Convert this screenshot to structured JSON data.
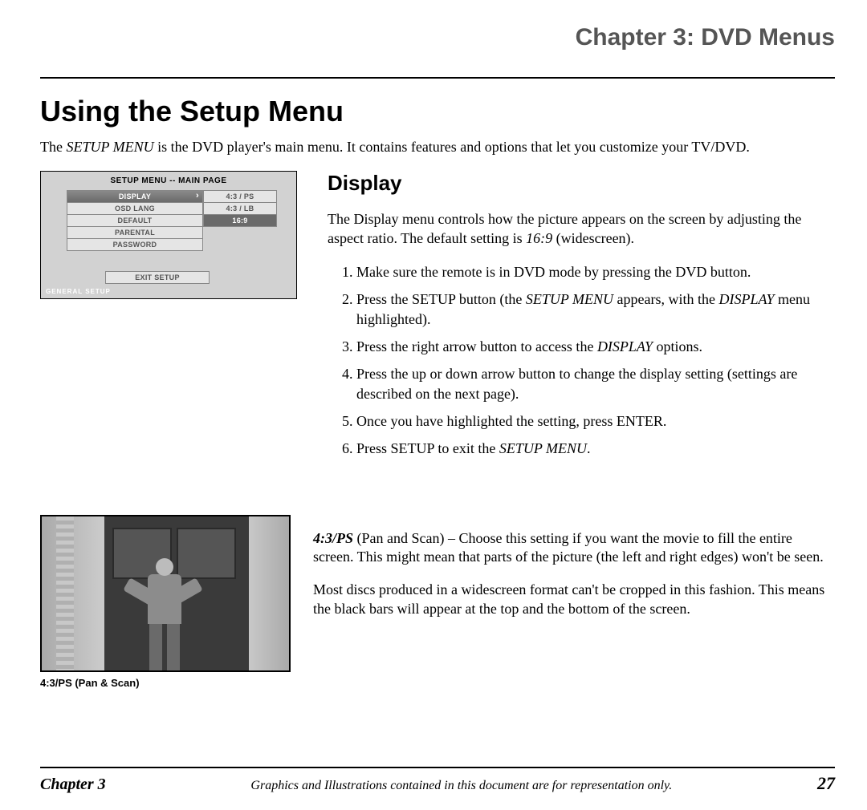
{
  "header": {
    "chapter_title": "Chapter 3: DVD Menus"
  },
  "section": {
    "title": "Using the Setup Menu",
    "intro_pre": "The ",
    "intro_em": "SETUP MENU",
    "intro_post": " is the DVD player's main menu. It contains features and options that let you customize your TV/DVD."
  },
  "menu_fig": {
    "title": "SETUP MENU -- MAIN PAGE",
    "left_items": [
      "DISPLAY",
      "OSD LANG",
      "DEFAULT",
      "PARENTAL",
      "PASSWORD"
    ],
    "right_items": [
      "4:3 / PS",
      "4:3 / LB",
      "16:9"
    ],
    "exit": "EXIT SETUP",
    "footer": "GENERAL SETUP"
  },
  "display": {
    "heading": "Display",
    "body_a": "The Display menu controls how the picture appears on the screen by adjusting the aspect ratio. The default setting is ",
    "body_em": "16:9",
    "body_b": " (widescreen).",
    "steps": {
      "s1": "Make sure the remote is in DVD mode by pressing the DVD button.",
      "s2a": "Press the SETUP button (the ",
      "s2em1": "SETUP MENU",
      "s2b": " appears, with the ",
      "s2em2": "DISPLAY",
      "s2c": " menu highlighted).",
      "s3a": "Press the right arrow button to access the ",
      "s3em": "DISPLAY",
      "s3b": " options.",
      "s4": "Press the up or down arrow button to change the display setting (settings are described on the next page).",
      "s5": "Once you have highlighted the setting, press ENTER.",
      "s6a": "Press SETUP to exit the ",
      "s6em": "SETUP MENU",
      "s6b": "."
    }
  },
  "ps_block": {
    "caption": "4:3/PS (Pan & Scan)",
    "p1_em": "4:3/PS",
    "p1": " (Pan and Scan) –  Choose this setting if you want the movie to fill the entire screen. This might mean that parts of the picture (the left and right edges) won't be seen.",
    "p2": "Most discs produced in a widescreen format can't be cropped in this fashion. This means the black bars will appear at the top and the bottom of the screen."
  },
  "footer": {
    "left": "Chapter 3",
    "center": "Graphics and Illustrations contained in this document are for representation only.",
    "right": "27"
  }
}
